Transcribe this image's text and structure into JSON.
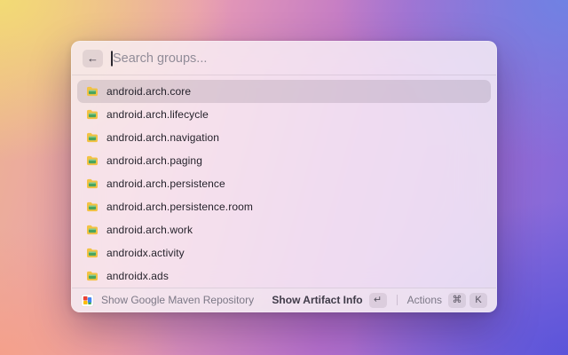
{
  "search": {
    "placeholder": "Search groups...",
    "value": "",
    "back_label": "←"
  },
  "list": {
    "items": [
      {
        "label": "android.arch.core",
        "selected": true
      },
      {
        "label": "android.arch.lifecycle",
        "selected": false
      },
      {
        "label": "android.arch.navigation",
        "selected": false
      },
      {
        "label": "android.arch.paging",
        "selected": false
      },
      {
        "label": "android.arch.persistence",
        "selected": false
      },
      {
        "label": "android.arch.persistence.room",
        "selected": false
      },
      {
        "label": "android.arch.work",
        "selected": false
      },
      {
        "label": "androidx.activity",
        "selected": false
      },
      {
        "label": "androidx.ads",
        "selected": false
      }
    ],
    "item_icon": "folder-icon"
  },
  "footer": {
    "app_name": "Show Google Maven Repository",
    "primary_action": {
      "label": "Show Artifact Info",
      "key": "↵"
    },
    "secondary_action": {
      "label": "Actions",
      "keys": [
        "⌘",
        "K"
      ]
    }
  },
  "colors": {
    "folder_yellow": "#f2c243",
    "folder_green": "#4aa55e",
    "selection_highlight": "#d5cdd6",
    "panel_tint": "#f6eef3",
    "bg_top_left": "#f3dd73",
    "bg_top_right": "#6e83e4",
    "bg_bottom_left": "#f5a08a",
    "bg_bottom_right": "#5a53d9",
    "bg_center": "#b56fcc"
  }
}
